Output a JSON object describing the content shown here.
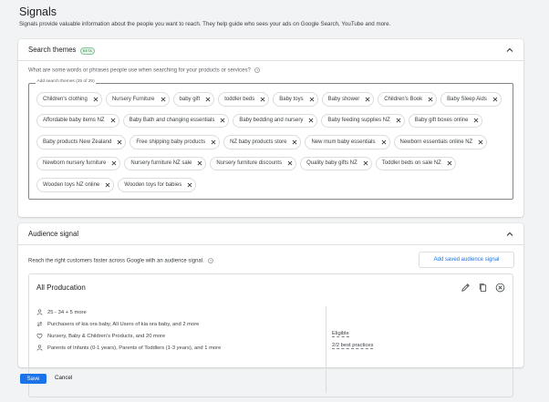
{
  "page": {
    "title": "Signals",
    "description": "Signals provide valuable information about the people you want to reach. They help guide who sees your ads on Google Search, YouTube and more."
  },
  "search_themes": {
    "title": "Search themes",
    "badge": "BETA",
    "question": "What are some words or phrases people use when searching for your products or services?",
    "field_label": "Add search themes (25 of 25)",
    "themes": [
      "Children's clothing",
      "Nursery Furniture",
      "baby gift",
      "toddler beds",
      "Baby toys",
      "Baby shower",
      "Children's Book",
      "Baby Sleep Aids",
      "Affordable baby items NZ",
      "Baby Bath and changing essentials",
      "Baby bedding and nursery",
      "Baby feeding supplies NZ",
      "Baby gift boxes online",
      "Baby products New Zealand",
      "Free shipping baby products",
      "NZ baby products store",
      "New mum baby essentials",
      "Newborn essentials online NZ",
      "Newborn nursery furniture",
      "Nursery furniture NZ sale",
      "Nursery furniture discounts",
      "Quality baby gifts NZ",
      "Toddler beds on sale NZ",
      "Wooden toys NZ online",
      "Wooden toys for babies"
    ]
  },
  "audience_signal": {
    "title": "Audience signal",
    "description": "Reach the right customers faster across Google with an audience signal.",
    "add_saved_label": "Add saved audience signal",
    "audience": {
      "name": "All Producation",
      "demographics": "25 - 34 + 5 more",
      "purchasers": "Purchasers of kia ora baby, All Users of kia ora baby, and 2 more",
      "interests": "Nursery, Baby & Children's Products, and 20 more",
      "parents": "Parents of Infants (0-1 years), Parents of Toddlers (1-3 years), and 1 more",
      "status_eligible": "Eligible",
      "status_practices": "2/2 best practices"
    }
  },
  "footer": {
    "save_label": "Save",
    "cancel_label": "Cancel"
  },
  "colors": {
    "accent": "#1a73e8",
    "beta_green": "#188038"
  }
}
